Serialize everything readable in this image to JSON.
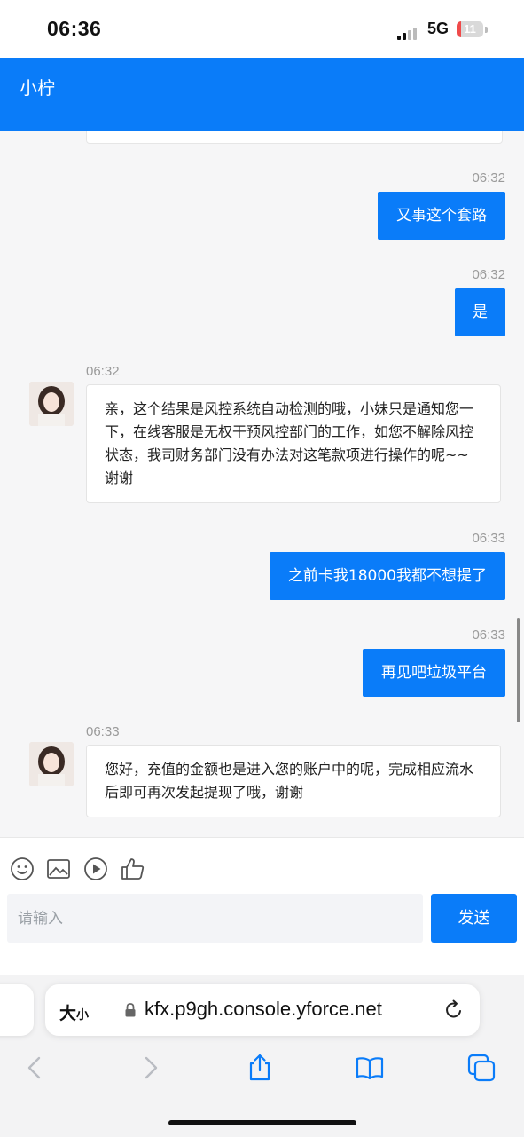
{
  "status_bar": {
    "time": "06:36",
    "network": "5G",
    "battery": "11"
  },
  "chat": {
    "title": "小柠",
    "messages": [
      {
        "side": "out",
        "time": "06:32",
        "text": "又事这个套路"
      },
      {
        "side": "out",
        "time": "06:32",
        "text": "是"
      },
      {
        "side": "in",
        "time": "06:32",
        "text": "亲，这个结果是风控系统自动检测的哦，小妹只是通知您一下，在线客服是无权干预风控部门的工作，如您不解除风控状态，我司财务部门没有办法对这笔款项进行操作的呢~~谢谢"
      },
      {
        "side": "out",
        "time": "06:33",
        "text": "之前卡我18000我都不想提了"
      },
      {
        "side": "out",
        "time": "06:33",
        "text": "再见吧垃圾平台"
      },
      {
        "side": "in",
        "time": "06:33",
        "text": "您好，充值的金额也是进入您的账户中的呢，完成相应流水后即可再次发起提现了哦，谢谢"
      }
    ]
  },
  "toolbar": {
    "icons": [
      "emoji-icon",
      "image-icon",
      "video-icon",
      "thumbs-up-icon"
    ]
  },
  "composer": {
    "placeholder": "请输入",
    "value": "",
    "send_label": "发送"
  },
  "browser": {
    "text_size_label": "大",
    "text_size_small": "小",
    "url": "kfx.p9gh.console.yforce.net",
    "nav_icons": [
      "back-icon",
      "forward-icon",
      "share-icon",
      "bookmarks-icon",
      "tabs-icon"
    ]
  },
  "colors": {
    "accent": "#0a7cf9",
    "background": "#f6f6f7",
    "battery_low": "#f04a4a"
  }
}
